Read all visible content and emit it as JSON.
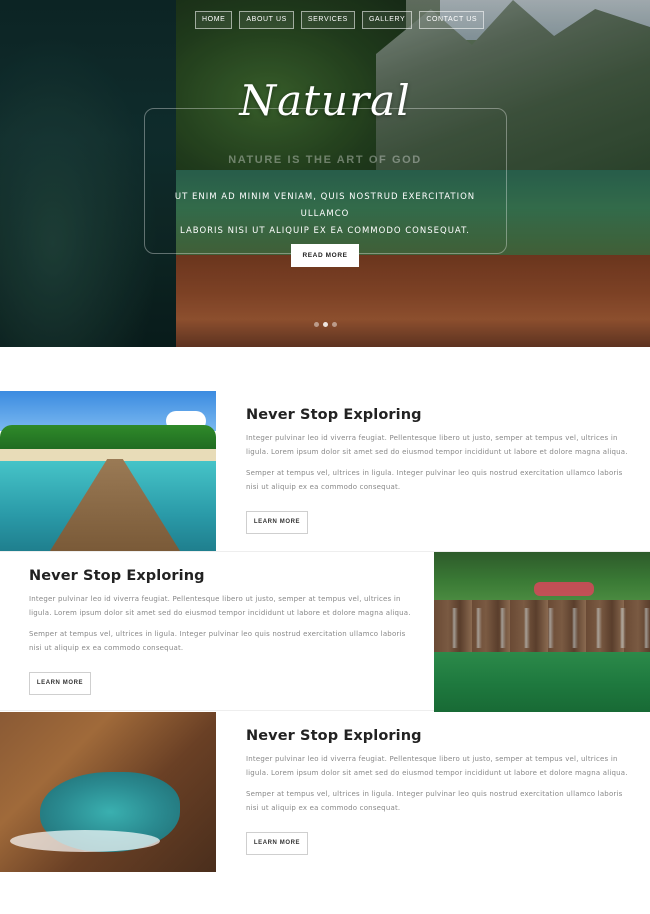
{
  "nav": {
    "items": [
      {
        "label": "HOME"
      },
      {
        "label": "ABOUT US"
      },
      {
        "label": "SERVICES"
      },
      {
        "label": "GALLERY"
      },
      {
        "label": "CONTACT US"
      }
    ]
  },
  "hero": {
    "title": "Natural",
    "subtitle": "NATURE IS THE ART OF GOD",
    "text_line1": "UT ENIM AD MINIM VENIAM, QUIS NOSTRUD EXERCITATION ULLAMCO",
    "text_line2": "LABORIS NISI UT ALIQUIP EX EA COMMODO CONSEQUAT.",
    "button": "READ MORE"
  },
  "features": [
    {
      "title": "Never Stop Exploring",
      "p1": "Integer pulvinar leo id viverra feugiat. Pellentesque libero ut justo, semper at tempus vel, ultrices in ligula. Lorem ipsum dolor sit amet sed do eiusmod tempor incididunt ut labore et dolore magna aliqua.",
      "p2": "Semper at tempus vel, ultrices in ligula. Integer pulvinar leo quis nostrud exercitation ullamco laboris nisi ut aliquip ex ea commodo consequat.",
      "button": "LEARN MORE"
    },
    {
      "title": "Never Stop Exploring",
      "p1": "Integer pulvinar leo id viverra feugiat. Pellentesque libero ut justo, semper at tempus vel, ultrices in ligula. Lorem ipsum dolor sit amet sed do eiusmod tempor incididunt ut labore et dolore magna aliqua.",
      "p2": "Semper at tempus vel, ultrices in ligula. Integer pulvinar leo quis nostrud exercitation ullamco laboris nisi ut aliquip ex ea commodo consequat.",
      "button": "LEARN MORE"
    },
    {
      "title": "Never Stop Exploring",
      "p1": "Integer pulvinar leo id viverra feugiat. Pellentesque libero ut justo, semper at tempus vel, ultrices in ligula. Lorem ipsum dolor sit amet sed do eiusmod tempor incididunt ut labore et dolore magna aliqua.",
      "p2": "Semper at tempus vel, ultrices in ligula. Integer pulvinar leo quis nostrud exercitation ullamco laboris nisi ut aliquip ex ea commodo consequat.",
      "button": "LEARN MORE"
    }
  ],
  "colors": {
    "accent": "#ffffff",
    "text_dark": "#222222",
    "text_muted": "#888888"
  }
}
